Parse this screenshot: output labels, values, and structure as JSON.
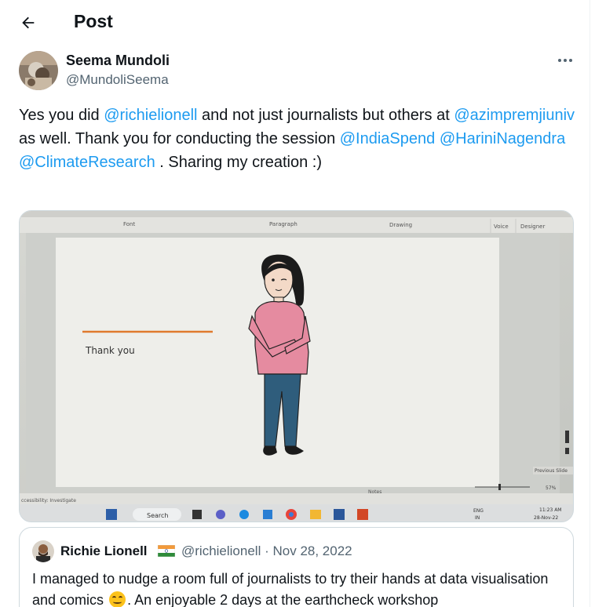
{
  "header": {
    "title": "Post"
  },
  "post": {
    "author": {
      "name": "Seema Mundoli",
      "handle": "@MundoliSeema"
    },
    "text": {
      "p1": "Yes you did ",
      "m1": "@richielionell",
      "p2": " and not just journalists but others at ",
      "m2": "@azimpremjiuniv",
      "p3": " as well. Thank you for conducting the session ",
      "m3": "@IndiaSpend",
      "p4": " ",
      "m4": "@HariniNagendra",
      "p5": " ",
      "m5": "@ClimateResearch",
      "p6": " . Sharing my creation :)"
    },
    "media": {
      "ribbon": {
        "font": "Font",
        "paragraph": "Paragraph",
        "drawing": "Drawing",
        "voice": "Voice",
        "designer": "Designer"
      },
      "slide_text": "Thank you",
      "status_left": "ccessibility: Investigate",
      "notes": "Notes",
      "zoom": "57%",
      "prev_slide": "Previous Slide",
      "taskbar": {
        "search": "Search",
        "lang1": "ENG",
        "lang2": "IN",
        "time": "11:23 AM",
        "date": "28-Nov-22"
      }
    }
  },
  "quote": {
    "name": "Richie Lionell",
    "handle": "@richielionell",
    "dot": "·",
    "date": "Nov 28, 2022",
    "text1": "I managed to nudge a room full of journalists to try their hands at data visualisation and comics",
    "text2": ".  An enjoyable 2 days at the earthcheck workshop"
  },
  "colors": {
    "mention": "#1d9bf0",
    "secondary_text": "#536471",
    "accent_line": "#e07a2e"
  }
}
